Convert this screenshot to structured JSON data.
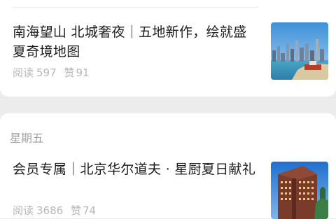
{
  "articles": [
    {
      "title": "南海望山 北城奢夜｜五地新作，绘就盛夏奇境地图",
      "reads_label": "阅读",
      "reads": "597",
      "likes_label": "赞",
      "likes": "91",
      "thumbnail": "coastal-city-skyline-image"
    }
  ],
  "group": {
    "day_label": "星期五",
    "articles": [
      {
        "title": "会员专属｜北京华尔道夫 · 星厨夏日献礼",
        "reads_label": "阅读",
        "reads": "3686",
        "likes_label": "赞",
        "likes": "74",
        "thumbnail": "hotel-building-image"
      }
    ]
  }
}
